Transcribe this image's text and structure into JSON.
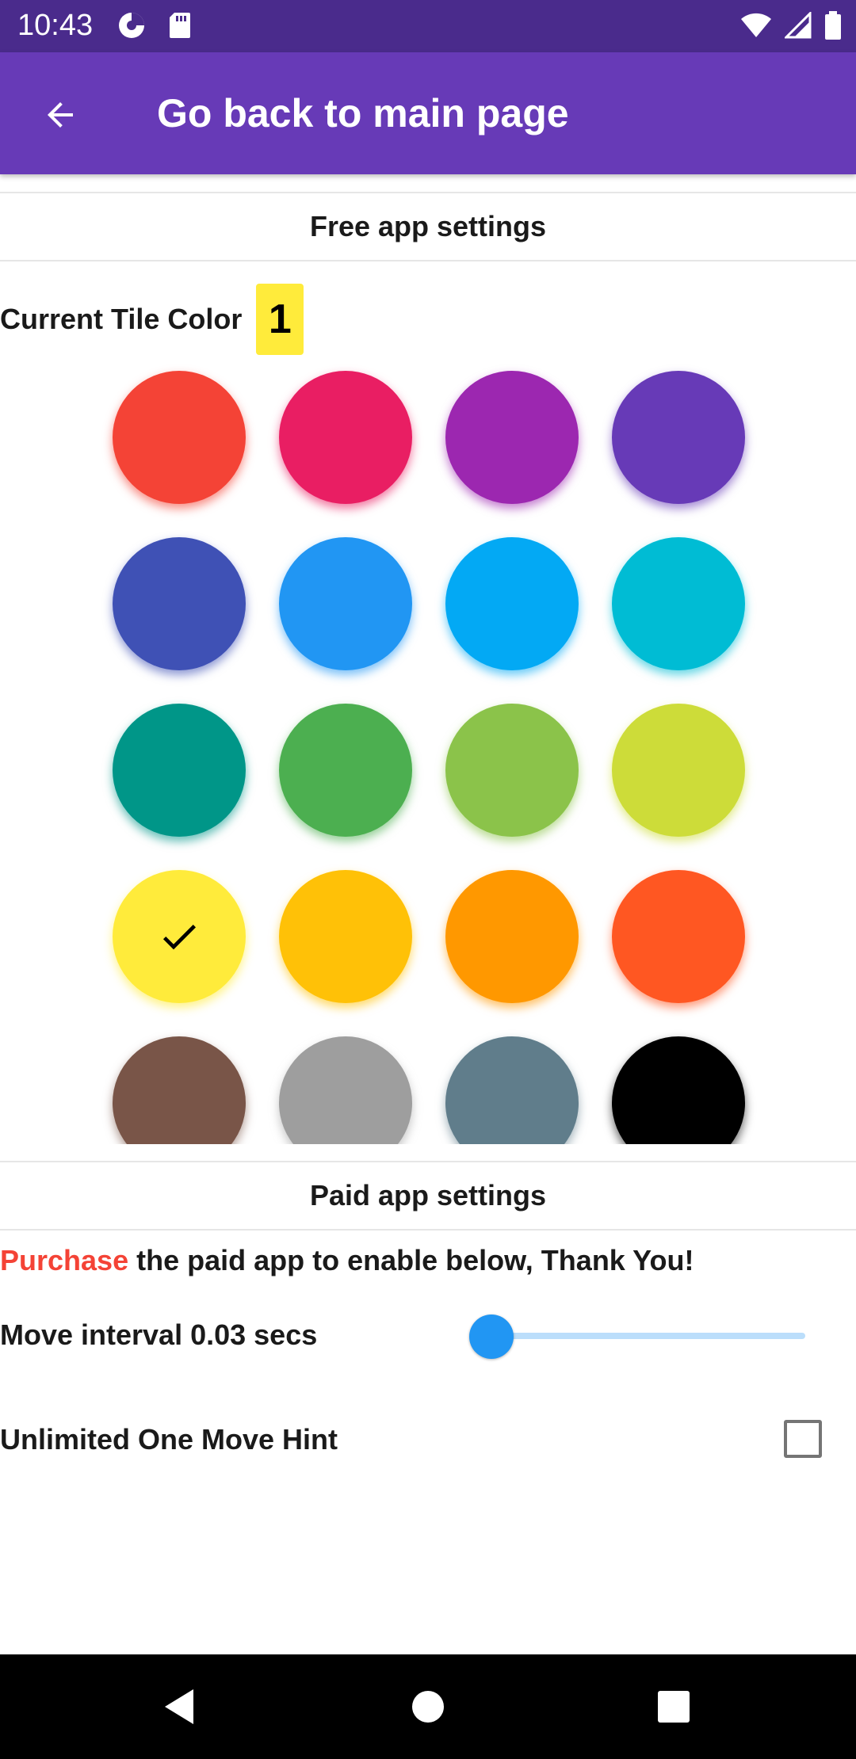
{
  "status_bar": {
    "time": "10:43",
    "icons": [
      "data-saver-icon",
      "sd-card-icon",
      "wifi-icon",
      "signal-icon",
      "battery-icon"
    ]
  },
  "app_bar": {
    "title": "Go back to main page",
    "back_icon": "arrow-back-icon",
    "color": "#673ab7"
  },
  "free_settings": {
    "header": "Free app settings",
    "tile_color_label": "Current Tile Color",
    "tile_number": "1",
    "selected_index": 12,
    "swatches": [
      {
        "name": "red",
        "color": "#f44336"
      },
      {
        "name": "pink",
        "color": "#e91e63"
      },
      {
        "name": "purple",
        "color": "#9c27b0"
      },
      {
        "name": "deep-purple",
        "color": "#673ab7"
      },
      {
        "name": "indigo",
        "color": "#3f51b5"
      },
      {
        "name": "blue",
        "color": "#2196f3"
      },
      {
        "name": "light-blue",
        "color": "#03a9f4"
      },
      {
        "name": "cyan",
        "color": "#00bcd4"
      },
      {
        "name": "teal",
        "color": "#009688"
      },
      {
        "name": "green",
        "color": "#4caf50"
      },
      {
        "name": "light-green",
        "color": "#8bc34a"
      },
      {
        "name": "lime",
        "color": "#cddc39"
      },
      {
        "name": "yellow",
        "color": "#ffeb3b"
      },
      {
        "name": "amber",
        "color": "#ffc107"
      },
      {
        "name": "orange",
        "color": "#ff9800"
      },
      {
        "name": "deep-orange",
        "color": "#ff5722"
      },
      {
        "name": "brown",
        "color": "#795548"
      },
      {
        "name": "grey",
        "color": "#9e9e9e"
      },
      {
        "name": "blue-grey",
        "color": "#607d8b"
      },
      {
        "name": "black",
        "color": "#000000"
      }
    ]
  },
  "paid_settings": {
    "header": "Paid app settings",
    "purchase_link": "Purchase",
    "purchase_text": " the paid app to enable below, Thank You!",
    "move_interval_label": "Move interval 0.03 secs",
    "move_interval_slider_level": 0.0,
    "hint_label": "Unlimited One Move Hint",
    "hint_checked": false
  },
  "nav_bar": {
    "icons": [
      "nav-back-icon",
      "nav-home-icon",
      "nav-recents-icon"
    ]
  }
}
